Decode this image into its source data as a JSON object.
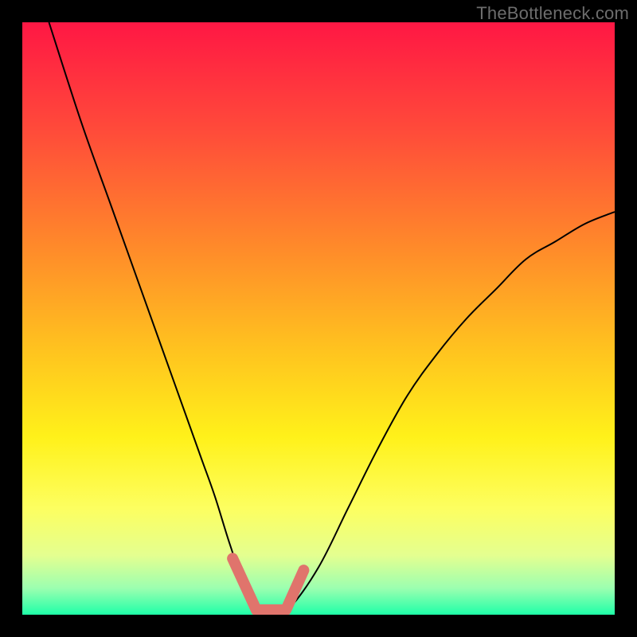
{
  "watermark": "TheBottleneck.com",
  "chart_data": {
    "type": "line",
    "title": "",
    "xlabel": "",
    "ylabel": "",
    "xlim": [
      0,
      1
    ],
    "ylim": [
      0,
      1
    ],
    "background_gradient": {
      "type": "vertical",
      "stops": [
        {
          "offset": 0.0,
          "color": "#ff1744"
        },
        {
          "offset": 0.18,
          "color": "#ff4a3a"
        },
        {
          "offset": 0.38,
          "color": "#ff8a2a"
        },
        {
          "offset": 0.55,
          "color": "#ffc21f"
        },
        {
          "offset": 0.7,
          "color": "#fff11a"
        },
        {
          "offset": 0.82,
          "color": "#fdff60"
        },
        {
          "offset": 0.9,
          "color": "#e4ff90"
        },
        {
          "offset": 0.955,
          "color": "#9cffb0"
        },
        {
          "offset": 1.0,
          "color": "#1fffa8"
        }
      ]
    },
    "series": [
      {
        "name": "bottleneck-curve",
        "stroke": "#000000",
        "stroke_width": 2,
        "x": [
          0.045,
          0.1,
          0.15,
          0.2,
          0.25,
          0.3,
          0.325,
          0.35,
          0.375,
          0.4,
          0.425,
          0.45,
          0.5,
          0.55,
          0.6,
          0.65,
          0.7,
          0.75,
          0.8,
          0.85,
          0.9,
          0.95,
          1.0
        ],
        "y": [
          1.0,
          0.83,
          0.69,
          0.55,
          0.41,
          0.27,
          0.2,
          0.12,
          0.05,
          0.01,
          0.0,
          0.01,
          0.08,
          0.18,
          0.28,
          0.37,
          0.44,
          0.5,
          0.55,
          0.6,
          0.63,
          0.66,
          0.68
        ]
      },
      {
        "name": "highlight-segment",
        "stroke": "#e0746c",
        "stroke_width": 14,
        "linecap": "round",
        "x": [
          0.355,
          0.395,
          0.445,
          0.475
        ],
        "y": [
          0.095,
          0.008,
          0.008,
          0.075
        ]
      }
    ]
  }
}
